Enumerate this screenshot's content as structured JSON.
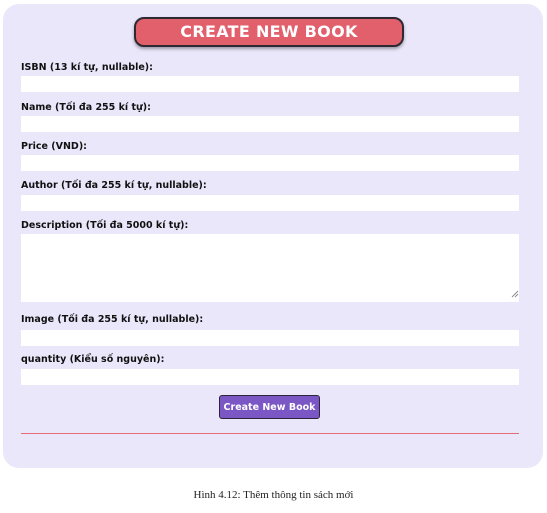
{
  "form": {
    "title": "CREATE NEW BOOK",
    "fields": [
      {
        "label": "ISBN (13 kí tự, nullable):",
        "value": ""
      },
      {
        "label": "Name (Tối đa 255 kí tự):",
        "value": ""
      },
      {
        "label": "Price (VND):",
        "value": ""
      },
      {
        "label": "Author (Tối đa 255 kí tự, nullable):",
        "value": ""
      },
      {
        "label": "Description (Tối đa 5000 kí tự):",
        "value": ""
      },
      {
        "label": "Image (Tối đa 255 kí tự, nullable):",
        "value": ""
      },
      {
        "label": "quantity (Kiểu số nguyên):",
        "value": ""
      }
    ],
    "submit_label": "Create New Book"
  },
  "caption": "Hình 4.12: Thêm thông tin sách mới",
  "colors": {
    "card_background": "#ebe7fb",
    "title_button": "#e25f6c",
    "submit_button": "#7a57c4",
    "divider": "#e66b76"
  }
}
